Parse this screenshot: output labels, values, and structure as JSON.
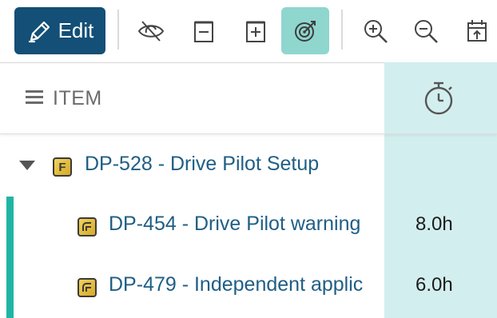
{
  "toolbar": {
    "edit_label": "Edit",
    "icons": [
      {
        "name": "hide-icon",
        "active": false
      },
      {
        "name": "collapse-icon",
        "active": false
      },
      {
        "name": "expand-icon",
        "active": false
      },
      {
        "name": "target-icon",
        "active": true
      },
      {
        "name": "zoom-in-icon",
        "active": false
      },
      {
        "name": "zoom-out-icon",
        "active": false
      },
      {
        "name": "calendar-icon",
        "active": false
      }
    ],
    "colors": {
      "edit_bg": "#134f76",
      "active_bg": "#8fd6cf"
    }
  },
  "header": {
    "item_label": "ITEM",
    "timer_icon": "stopwatch-icon"
  },
  "rows": [
    {
      "id_title": "DP-528 - Drive Pilot Setup",
      "type_icon": "feature-icon",
      "type_glyph": "F",
      "expanded": true,
      "hours": ""
    },
    {
      "id_title": "DP-454 - Drive Pilot warning",
      "type_icon": "story-icon",
      "hours": "8.0h"
    },
    {
      "id_title": "DP-479 - Independent applic",
      "type_icon": "story-icon",
      "hours": "6.0h"
    }
  ],
  "colors": {
    "link": "#1f5e85",
    "timer_column": "#d3eeee",
    "selection_bar": "#1fb5a4"
  }
}
